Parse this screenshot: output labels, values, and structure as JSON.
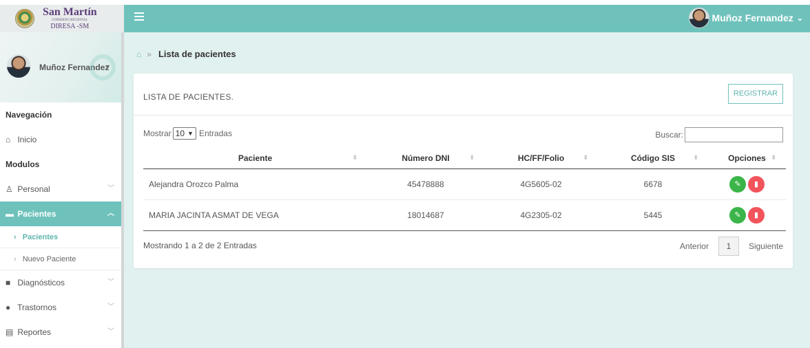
{
  "brand": {
    "title": "San Martín",
    "subtitle": "GOBIERNO REGIONAL",
    "org": "DIRESA -SM",
    "accent": "#6fc2bc"
  },
  "topbar": {
    "user_name": "Muñoz Fernandez",
    "menu_icon": "hamburger-icon",
    "caret": "⌄"
  },
  "sidebar": {
    "profile_name": "Muñoz Fernandez",
    "sections": {
      "navegacion": "Navegación",
      "modulos": "Modulos"
    },
    "items": {
      "inicio": "Inicio",
      "personal": "Personal",
      "pacientes": "Pacientes",
      "pacientes_sub": "Pacientes",
      "nuevo_paciente": "Nuevo Paciente",
      "diagnosticos": "Diagnósticos",
      "trastornos": "Trastornos",
      "reportes": "Reportes"
    }
  },
  "breadcrumb": {
    "separator": "»",
    "title": "Lista de pacientes"
  },
  "card": {
    "title": "LISTA DE PACIENTES.",
    "register_label": "REGISTRAR"
  },
  "controls": {
    "show_label": "Mostrar",
    "page_size": "10",
    "entries_label": "Entradas",
    "search_label": "Buscar:",
    "search_value": ""
  },
  "table": {
    "headers": [
      "Paciente",
      "Número DNI",
      "HC/FF/Folio",
      "Código SIS",
      "Opciones"
    ],
    "rows": [
      {
        "paciente": "Alejandra Orozco Palma",
        "dni": "45478888",
        "folio": "4G5605-02",
        "sis": "6678"
      },
      {
        "paciente": "MARIA JACINTA ASMAT DE VEGA",
        "dni": "18014687",
        "folio": "4G2305-02",
        "sis": "5445"
      }
    ]
  },
  "footer": {
    "info": "Mostrando 1 a 2 de 2 Entradas",
    "prev": "Anterior",
    "page": "1",
    "next": "Siguiente"
  }
}
